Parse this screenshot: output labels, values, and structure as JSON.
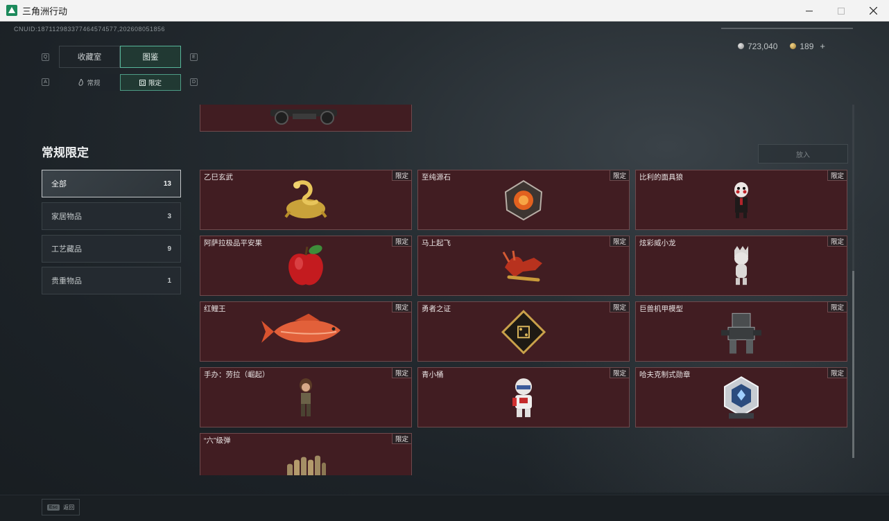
{
  "window": {
    "title": "三角洲行动",
    "min_icon": "minimize-icon",
    "max_icon": "maximize-icon",
    "close_icon": "close-icon"
  },
  "header": {
    "uid": "CNUID:187112983377464574577,202608051856",
    "currency_silver": "723,040",
    "currency_gold": "189",
    "add_label": "+"
  },
  "tabs": [
    {
      "label": "收藏室",
      "active": false
    },
    {
      "label": "图鉴",
      "active": true
    }
  ],
  "tab_keys": {
    "left": "Q",
    "right": "E"
  },
  "subtabs": [
    {
      "label": "常规",
      "icon": "flame-icon",
      "active": false
    },
    {
      "label": "限定",
      "icon": "frame-icon",
      "active": true
    }
  ],
  "subtab_keys": {
    "left": "A",
    "right": "D"
  },
  "section": {
    "title": "常规限定",
    "put_button": "放入"
  },
  "categories": [
    {
      "label": "全部",
      "count": "13",
      "active": true
    },
    {
      "label": "家居物品",
      "count": "3",
      "active": false
    },
    {
      "label": "工艺藏品",
      "count": "9",
      "active": false
    },
    {
      "label": "贵重物品",
      "count": "1",
      "active": false
    }
  ],
  "badge_label": "限定",
  "items": [
    {
      "name": "乙巳玄武",
      "icon": "gold-snake-turtle-icon"
    },
    {
      "name": "至纯源石",
      "icon": "origin-stone-icon"
    },
    {
      "name": "比利的面具狼",
      "icon": "puppet-mask-icon"
    },
    {
      "name": "阿萨拉极品平安果",
      "icon": "red-apple-icon"
    },
    {
      "name": "马上起飞",
      "icon": "red-horse-icon"
    },
    {
      "name": "炫彩威小龙",
      "icon": "white-dragon-figure-icon"
    },
    {
      "name": "红鲤王",
      "icon": "red-carp-icon"
    },
    {
      "name": "勇者之证",
      "icon": "gold-medallion-icon"
    },
    {
      "name": "巨兽机甲模型",
      "icon": "mech-model-icon"
    },
    {
      "name": "手办：劳拉（崛起）",
      "icon": "lara-figure-icon"
    },
    {
      "name": "青小桶",
      "icon": "chibi-figure-icon"
    },
    {
      "name": "哈夫克制式勋章",
      "icon": "hexagon-medal-icon"
    },
    {
      "name": "“六”级弹",
      "icon": "bullet-cluster-icon"
    }
  ],
  "top_partial_item": {
    "icon": "gun-icon"
  },
  "footer": {
    "esc_key": "Esc",
    "back_label": "返回"
  }
}
